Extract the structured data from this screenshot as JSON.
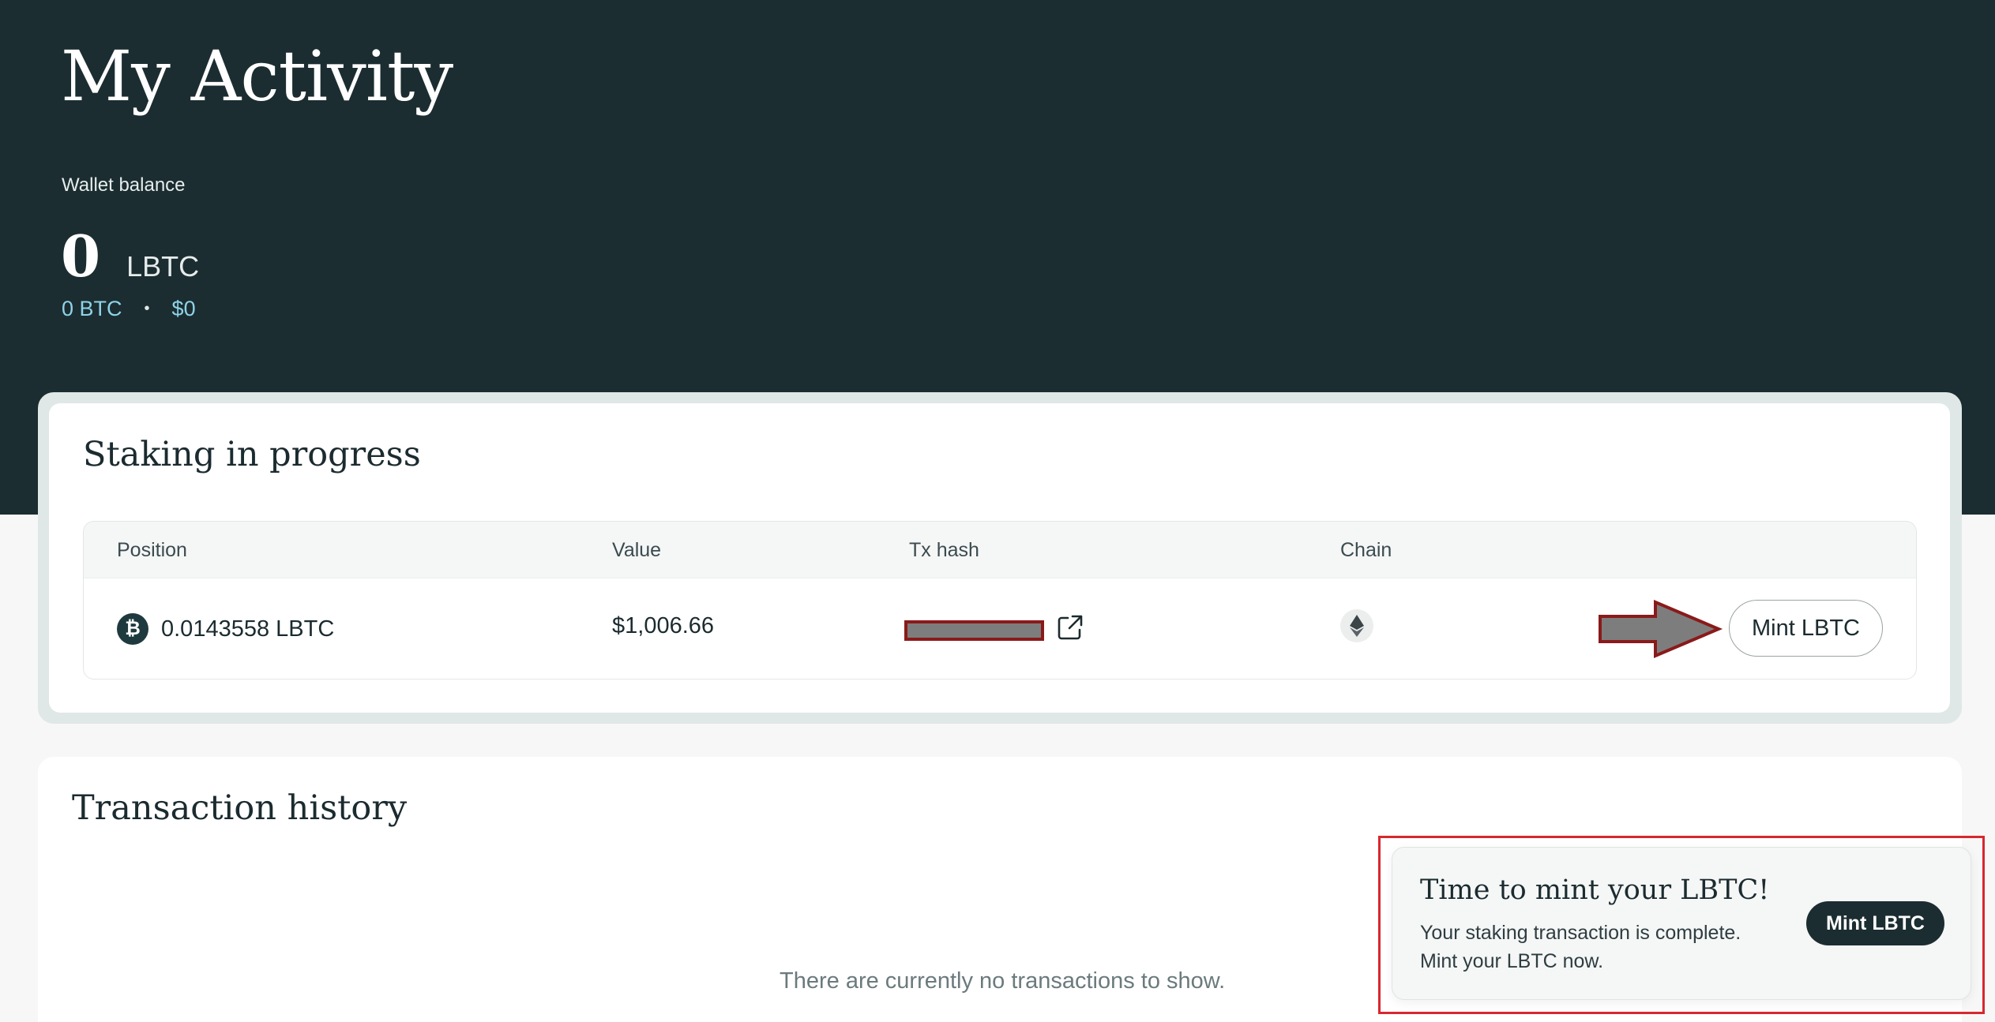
{
  "header": {
    "title": "My Activity",
    "wallet_label": "Wallet balance",
    "balance_value": "0",
    "balance_unit": "LBTC",
    "btc_value": "0 BTC",
    "separator": "•",
    "usd_value": "$0"
  },
  "staking": {
    "title": "Staking in progress",
    "columns": [
      "Position",
      "Value",
      "Tx hash",
      "Chain"
    ],
    "rows": [
      {
        "position": "0.0143558 LBTC",
        "value": "$1,006.66",
        "tx_hash": "",
        "chain_icon": "ethereum-icon",
        "action": "Mint LBTC"
      }
    ]
  },
  "history": {
    "title": "Transaction history",
    "empty_text": "There are currently no transactions to show."
  },
  "toast": {
    "title": "Time to mint your LBTC!",
    "text": "Your staking transaction is complete. Mint your LBTC now.",
    "button": "Mint LBTC"
  },
  "colors": {
    "hero_bg": "#1b2d31",
    "accent_text": "#8fd3e8",
    "annotation_red": "#d7282f",
    "annotation_arrow": "#8a1a1a"
  }
}
